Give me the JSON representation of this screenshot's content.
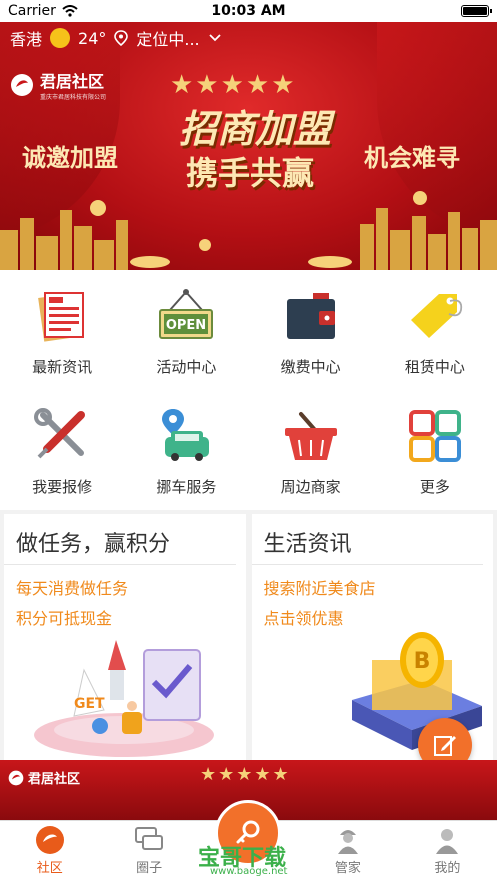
{
  "status_bar": {
    "carrier": "Carrier",
    "time": "10:03 AM"
  },
  "top_bar": {
    "city": "香港",
    "temperature": "24°",
    "location": "定位中..."
  },
  "banner": {
    "brand_name": "君居社区",
    "brand_sub": "重庆市君居科技有限公司",
    "headline": "招商加盟",
    "subline": "携手共赢",
    "left_text": "诚邀加盟",
    "right_text": "机会难寻"
  },
  "grid": [
    {
      "label": "最新资讯",
      "icon": "news-icon"
    },
    {
      "label": "活动中心",
      "icon": "open-sign-icon",
      "sign_text": "OPEN"
    },
    {
      "label": "缴费中心",
      "icon": "wallet-icon"
    },
    {
      "label": "租赁中心",
      "icon": "tag-icon"
    },
    {
      "label": "我要报修",
      "icon": "tools-icon"
    },
    {
      "label": "挪车服务",
      "icon": "car-location-icon"
    },
    {
      "label": "周边商家",
      "icon": "basket-icon"
    },
    {
      "label": "更多",
      "icon": "grid-more-icon"
    }
  ],
  "cards": [
    {
      "title": "做任务，赢积分",
      "line1": "每天消费做任务",
      "line2": "积分可抵现金"
    },
    {
      "title": "生活资讯",
      "line1": "搜索附近美食店",
      "line2": "点击领优惠"
    }
  ],
  "strip": {
    "brand_name": "君居社区"
  },
  "tabs": [
    {
      "label": "社区",
      "active": true
    },
    {
      "label": "圈子",
      "active": false
    },
    {
      "label": "",
      "active": false
    },
    {
      "label": "管家",
      "active": false
    },
    {
      "label": "我的",
      "active": false
    }
  ],
  "watermark": {
    "text": "宝哥下载",
    "url": "www.baoge.net"
  },
  "colors": {
    "accent": "#f2702a",
    "banner_red": "#b30f14",
    "text_orange": "#f08a1c"
  }
}
